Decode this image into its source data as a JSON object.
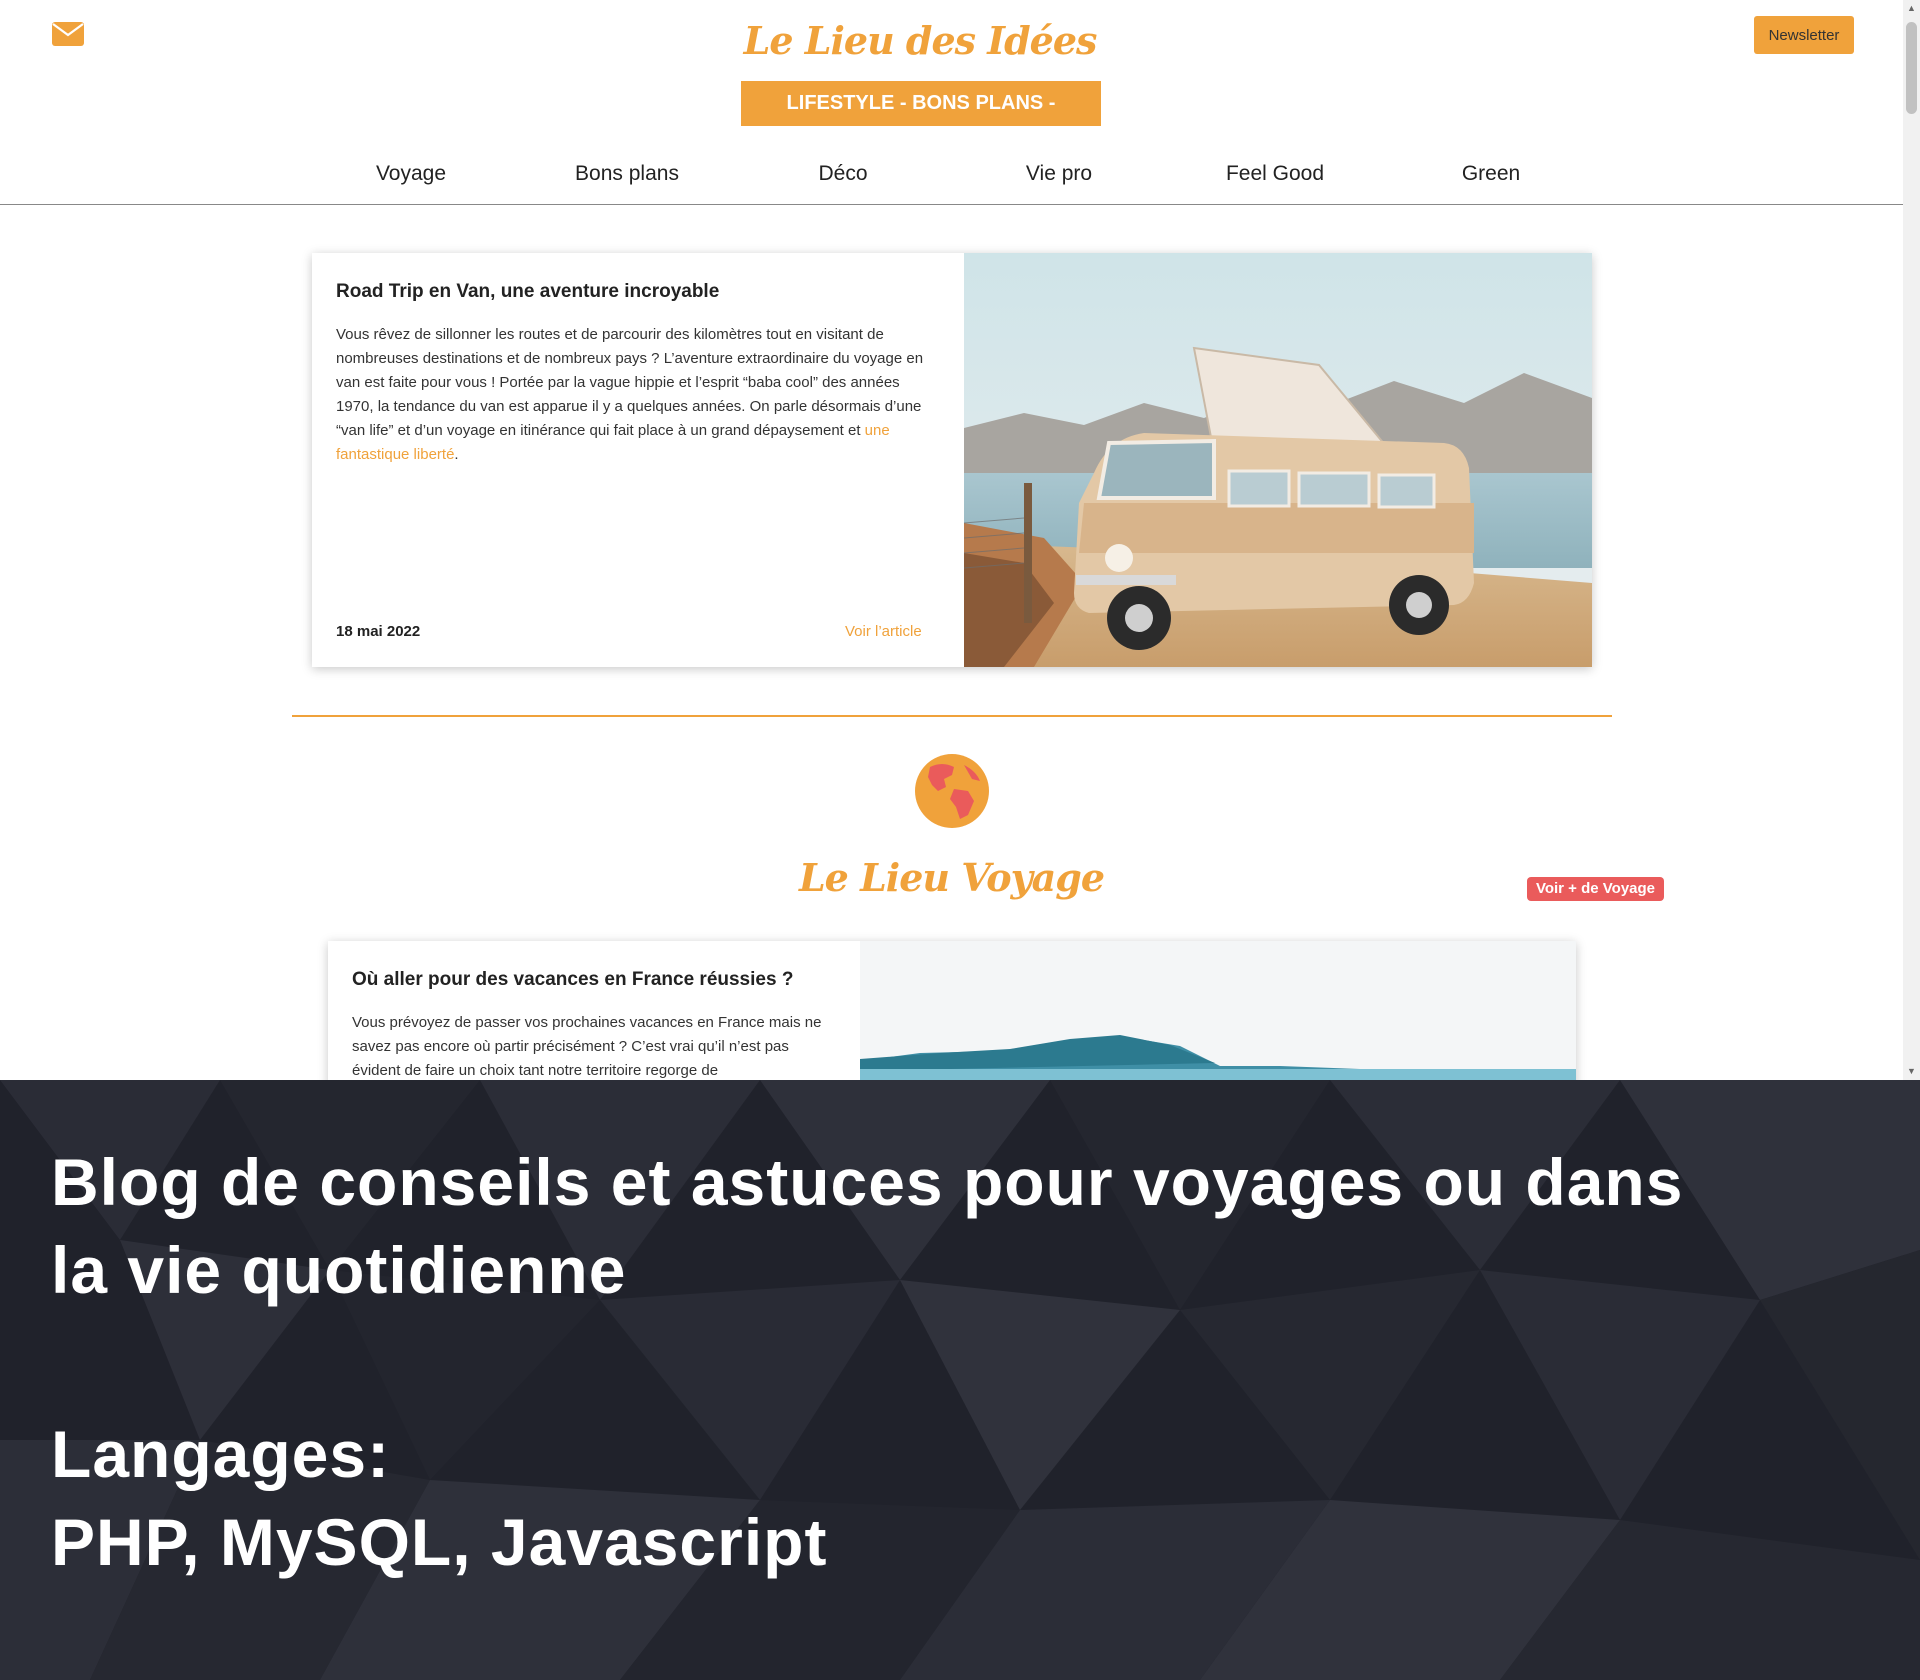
{
  "header": {
    "logo": "Le Lieu des Idées",
    "tagline": "LIFESTYLE - BONS PLANS - VOYAGES",
    "newsletter_label": "Newsletter",
    "mail_icon": "envelope-icon"
  },
  "nav": [
    {
      "label": "Voyage"
    },
    {
      "label": "Bons plans"
    },
    {
      "label": "Déco"
    },
    {
      "label": "Vie pro"
    },
    {
      "label": "Feel Good"
    },
    {
      "label": "Green"
    }
  ],
  "featured": {
    "title": "Road Trip en Van, une aventure incroyable",
    "text": "Vous rêvez de sillonner les routes et de parcourir des kilomètres tout en visitant de nombreuses destinations et de nombreux pays ? L’aventure extraordinaire du voyage en van est faite pour vous ! Portée par la vague hippie et l’esprit “baba cool” des années 1970, la tendance du van est apparue il y a quelques années. On parle désormais d’une “van life” et d’un voyage en itinérance qui fait place à un grand dépaysement et ",
    "text_link": "une fantastique liberté",
    "text_end": ".",
    "date": "18 mai 2022",
    "link_label": "Voir l’article"
  },
  "section": {
    "icon": "globe-icon",
    "title": "Le Lieu Voyage",
    "more_button": "Voir + de Voyage"
  },
  "article2": {
    "title": "Où aller pour des vacances en France réussies ?",
    "text": "Vous prévoyez de passer vos prochaines vacances en France mais ne savez pas encore où partir précisément ? C’est vrai qu’il n’est pas évident de faire un choix tant notre territoire regorge de"
  },
  "banner": {
    "line1": "Blog de conseils et astuces pour voyages ou dans",
    "line2": "la vie quotidienne",
    "line3": "Langages:",
    "line4": "PHP, MySQL, Javascript"
  },
  "colors": {
    "accent": "#f0a23b",
    "button_red": "#ea5b5b",
    "banner_bg": "#20222b"
  }
}
